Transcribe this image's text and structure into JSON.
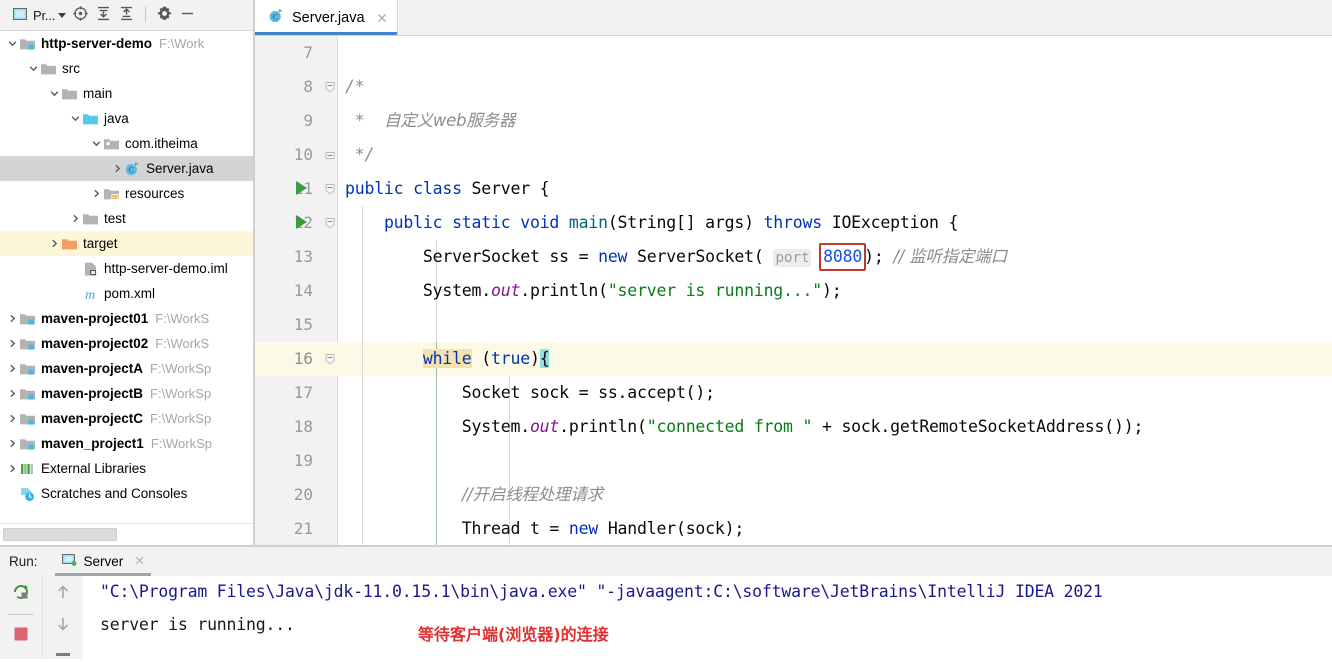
{
  "project_panel": {
    "toolbar": {
      "project_label": "Pr...",
      "locate_icon": "locate-target-icon",
      "expand_icon": "expand-all-icon",
      "collapse_icon": "collapse-all-icon",
      "settings_icon": "gear-icon",
      "hide_icon": "minimize-icon"
    },
    "tree": [
      {
        "label": "http-server-demo",
        "path": "F:\\Work",
        "indent": 0,
        "arrow": "down",
        "icon": "module-folder-icon",
        "bold": true,
        "state": "normal"
      },
      {
        "label": "src",
        "path": "",
        "indent": 1,
        "arrow": "down",
        "icon": "folder-icon",
        "bold": false,
        "state": "normal"
      },
      {
        "label": "main",
        "path": "",
        "indent": 2,
        "arrow": "down",
        "icon": "folder-icon",
        "bold": false,
        "state": "normal"
      },
      {
        "label": "java",
        "path": "",
        "indent": 3,
        "arrow": "down",
        "icon": "source-folder-icon",
        "bold": false,
        "state": "normal"
      },
      {
        "label": "com.itheima",
        "path": "",
        "indent": 4,
        "arrow": "down",
        "icon": "package-icon",
        "bold": false,
        "state": "normal"
      },
      {
        "label": "Server.java",
        "path": "",
        "indent": 5,
        "arrow": "right",
        "icon": "java-class-icon",
        "bold": false,
        "state": "selected"
      },
      {
        "label": "resources",
        "path": "",
        "indent": 4,
        "arrow": "right",
        "icon": "resources-folder-icon",
        "bold": false,
        "state": "normal"
      },
      {
        "label": "test",
        "path": "",
        "indent": 3,
        "arrow": "right",
        "icon": "folder-icon",
        "bold": false,
        "state": "normal"
      },
      {
        "label": "target",
        "path": "",
        "indent": 2,
        "arrow": "right",
        "icon": "target-folder-icon",
        "bold": false,
        "state": "highlighted"
      },
      {
        "label": "http-server-demo.iml",
        "path": "",
        "indent": 3,
        "arrow": "none",
        "icon": "iml-file-icon",
        "bold": false,
        "state": "normal"
      },
      {
        "label": "pom.xml",
        "path": "",
        "indent": 3,
        "arrow": "none",
        "icon": "maven-pom-icon",
        "bold": false,
        "state": "normal"
      },
      {
        "label": "maven-project01",
        "path": "F:\\WorkS",
        "indent": 0,
        "arrow": "right",
        "icon": "module-folder-icon",
        "bold": true,
        "state": "normal"
      },
      {
        "label": "maven-project02",
        "path": "F:\\WorkS",
        "indent": 0,
        "arrow": "right",
        "icon": "module-folder-icon",
        "bold": true,
        "state": "normal"
      },
      {
        "label": "maven-projectA",
        "path": "F:\\WorkSp",
        "indent": 0,
        "arrow": "right",
        "icon": "module-folder-icon",
        "bold": true,
        "state": "normal"
      },
      {
        "label": "maven-projectB",
        "path": "F:\\WorkSp",
        "indent": 0,
        "arrow": "right",
        "icon": "module-folder-icon",
        "bold": true,
        "state": "normal"
      },
      {
        "label": "maven-projectC",
        "path": "F:\\WorkSp",
        "indent": 0,
        "arrow": "right",
        "icon": "module-folder-icon",
        "bold": true,
        "state": "normal"
      },
      {
        "label": "maven_project1",
        "path": "F:\\WorkSp",
        "indent": 0,
        "arrow": "right",
        "icon": "module-folder-icon",
        "bold": true,
        "state": "normal"
      },
      {
        "label": "External Libraries",
        "path": "",
        "indent": 0,
        "arrow": "right",
        "icon": "libraries-icon",
        "bold": false,
        "state": "normal"
      },
      {
        "label": "Scratches and Consoles",
        "path": "",
        "indent": 0,
        "arrow": "none",
        "icon": "scratches-icon",
        "bold": false,
        "state": "normal"
      }
    ]
  },
  "editor": {
    "tab": {
      "name": "Server.java",
      "icon": "java-class-icon",
      "close_icon": "close-icon"
    },
    "first_line_number": 7,
    "lines": [
      {
        "n": 7,
        "run": false,
        "fold": "none"
      },
      {
        "n": 8,
        "run": false,
        "fold": "start"
      },
      {
        "n": 9,
        "run": false,
        "fold": "none"
      },
      {
        "n": 10,
        "run": false,
        "fold": "end"
      },
      {
        "n": 11,
        "run": true,
        "fold": "start"
      },
      {
        "n": 12,
        "run": true,
        "fold": "start"
      },
      {
        "n": 13,
        "run": false,
        "fold": "none"
      },
      {
        "n": 14,
        "run": false,
        "fold": "none"
      },
      {
        "n": 15,
        "run": false,
        "fold": "none"
      },
      {
        "n": 16,
        "run": false,
        "fold": "start"
      },
      {
        "n": 17,
        "run": false,
        "fold": "none"
      },
      {
        "n": 18,
        "run": false,
        "fold": "none"
      },
      {
        "n": 19,
        "run": false,
        "fold": "none"
      },
      {
        "n": 20,
        "run": false,
        "fold": "none"
      },
      {
        "n": 21,
        "run": false,
        "fold": "none"
      }
    ],
    "code": {
      "l8": "/*",
      "l9_star": "*",
      "l9_text": "自定义web服务器",
      "l10": "*/",
      "l11_kw1": "public",
      "l11_kw2": "class",
      "l11_name": "Server {",
      "l12_kw": "public static void",
      "l12_mth": "main",
      "l12_args": "(String[] args) ",
      "l12_throws": "throws",
      "l12_exc": " IOException {",
      "l13_a": "ServerSocket ss = ",
      "l13_new": "new",
      "l13_b": " ServerSocket(",
      "l13_hint": "port",
      "l13_port": "8080",
      "l13_c": "); ",
      "l13_cmt": "// 监听指定端口",
      "l14_a": "System.",
      "l14_out": "out",
      "l14_b": ".println(",
      "l14_str": "\"server is running...\"",
      "l14_c": ");",
      "l16_kw": "while",
      "l16_a": " (",
      "l16_true": "true",
      "l16_b": ")",
      "l16_brace": "{",
      "l17": "Socket sock = ss.accept();",
      "l18_a": "System.",
      "l18_out": "out",
      "l18_b": ".println(",
      "l18_str": "\"connected from \"",
      "l18_c": " + sock.getRemoteSocketAddress());",
      "l20_cmt": "//开启线程处理请求",
      "l21_a": "Thread t = ",
      "l21_new": "new",
      "l21_b": " Handler(sock);"
    }
  },
  "run_panel": {
    "label": "Run:",
    "tab_name": "Server",
    "tab_icon": "run-config-icon",
    "close_icon": "close-icon",
    "tools": {
      "rerun": "rerun-icon",
      "stop": "stop-icon",
      "up": "scroll-up-icon",
      "down": "scroll-down-icon",
      "soft_wrap": "soft-wrap-icon"
    },
    "console_lines": [
      {
        "text": "\"C:\\Program Files\\Java\\jdk-11.0.15.1\\bin\\java.exe\" \"-javaagent:C:\\software\\JetBrains\\IntelliJ IDEA 2021",
        "color": "blue"
      },
      {
        "text": "server is running...",
        "color": "dark"
      }
    ],
    "annotation": "等待客户端(浏览器)的连接"
  },
  "colors": {
    "accent_blue": "#4083c9",
    "keyword": "#0033b3",
    "string": "#067d17",
    "comment": "#8c8c8c",
    "field": "#871094",
    "annotation_red": "#e03030",
    "redbox_border": "#c0392b"
  }
}
